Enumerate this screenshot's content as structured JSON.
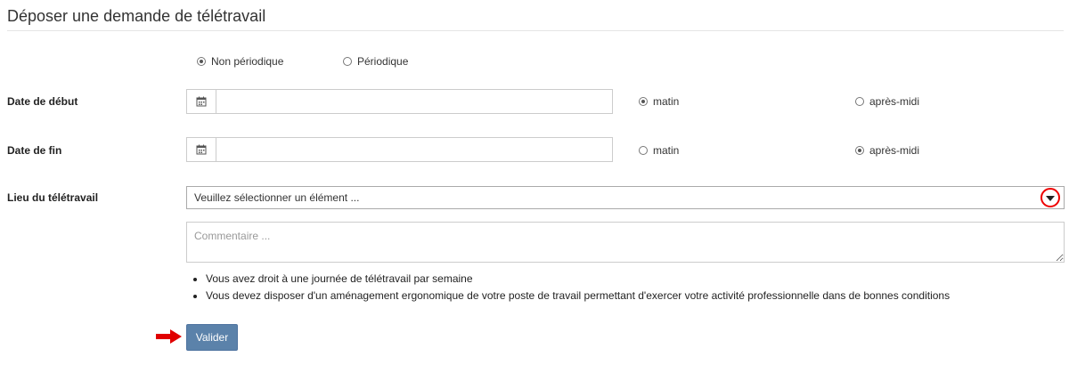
{
  "page": {
    "title": "Déposer une demande de télétravail"
  },
  "type_choice": {
    "options": [
      {
        "label": "Non périodique",
        "checked": true
      },
      {
        "label": "Périodique",
        "checked": false
      }
    ]
  },
  "start_date": {
    "label": "Date de début",
    "value": "",
    "calendar_icon": "calendar-icon",
    "period": [
      {
        "label": "matin",
        "checked": true
      },
      {
        "label": "après-midi",
        "checked": false
      }
    ]
  },
  "end_date": {
    "label": "Date de fin",
    "value": "",
    "calendar_icon": "calendar-icon",
    "period": [
      {
        "label": "matin",
        "checked": false
      },
      {
        "label": "après-midi",
        "checked": true
      }
    ]
  },
  "location": {
    "label": "Lieu du télétravail",
    "selected": "Veuillez sélectionner un élément ...",
    "dropdown_icon": "chevron-down-icon",
    "highlight_color": "#e00000"
  },
  "comment": {
    "placeholder": "Commentaire ...",
    "value": ""
  },
  "notes": [
    "Vous avez droit à une journée de télétravail par semaine",
    "Vous devez disposer d'un aménagement ergonomique de votre poste de travail permettant d'exercer votre activité professionnelle dans de bonnes conditions"
  ],
  "actions": {
    "submit_label": "Valider",
    "submit_color": "#5b82aa",
    "pointer_icon": "arrow-right-icon",
    "pointer_color": "#e00000"
  }
}
